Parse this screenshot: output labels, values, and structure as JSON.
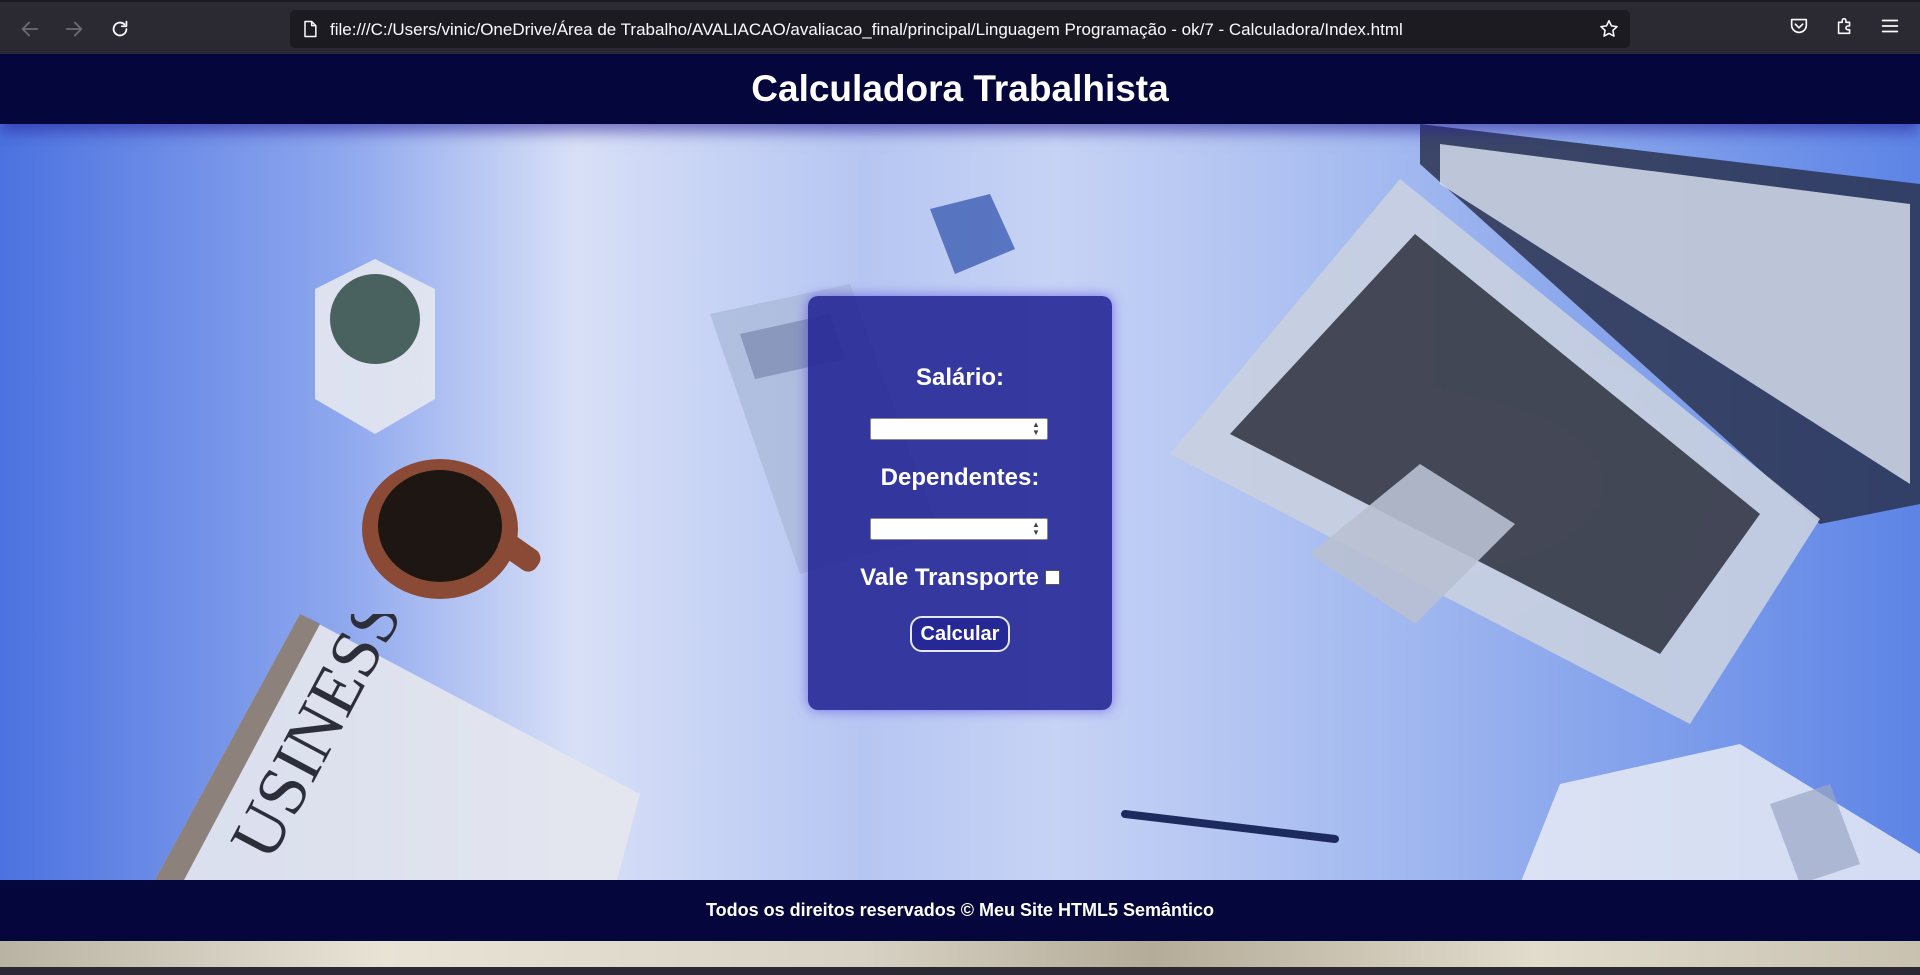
{
  "browser": {
    "url": "file:///C:/Users/vinic/OneDrive/Área de Trabalho/AVALIACAO/avaliacao_final/principal/Linguagem Programação - ok/7 - Calculadora/Index.html",
    "icons": [
      "back-arrow-icon",
      "forward-arrow-icon",
      "reload-icon",
      "page-icon",
      "star-icon",
      "pocket-icon",
      "extensions-icon",
      "menu-icon"
    ]
  },
  "header": {
    "title": "Calculadora Trabalhista"
  },
  "form": {
    "salario_label": "Salário:",
    "salario_value": "",
    "dependentes_label": "Dependentes:",
    "dependentes_value": "",
    "vale_transporte_label": "Vale Transporte",
    "vale_transporte_checked": false,
    "calcular_label": "Calcular"
  },
  "footer": {
    "text": "Todos os direitos reservados © Meu Site HTML5 Semântico"
  },
  "colors": {
    "header_bg": "#05063b",
    "card_bg": "#262896",
    "page_blue": "#4b72e0"
  }
}
